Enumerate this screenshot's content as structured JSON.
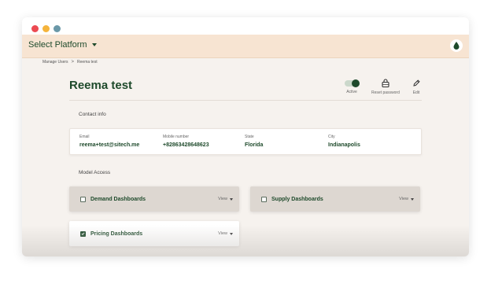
{
  "header": {
    "platform_select_label": "Select Platform"
  },
  "breadcrumb": {
    "parent": "Manage Users",
    "separator": ">",
    "current": "Reema test"
  },
  "user": {
    "name": "Reema test"
  },
  "actions": {
    "active_label": "Active",
    "active_state": true,
    "reset_password_label": "Reset password",
    "edit_label": "Edit"
  },
  "contact": {
    "section_title": "Contact info",
    "email_label": "Email",
    "email_value": "reema+test@sitech.me",
    "mobile_label": "Mobile number",
    "mobile_value": "+82863428648623",
    "state_label": "State",
    "state_value": "Florida",
    "city_label": "City",
    "city_value": "Indianapolis"
  },
  "model_access": {
    "section_title": "Model Access",
    "items": [
      {
        "name": "Demand Dashboards",
        "checked": false,
        "view_label": "View"
      },
      {
        "name": "Supply Dashboards",
        "checked": false,
        "view_label": "View"
      },
      {
        "name": "Pricing Dashboards",
        "checked": true,
        "view_label": "View"
      }
    ]
  },
  "colors": {
    "brand_green": "#1e4a2b",
    "header_bg": "#f7e4d2",
    "page_bg": "#f6f2ee"
  }
}
